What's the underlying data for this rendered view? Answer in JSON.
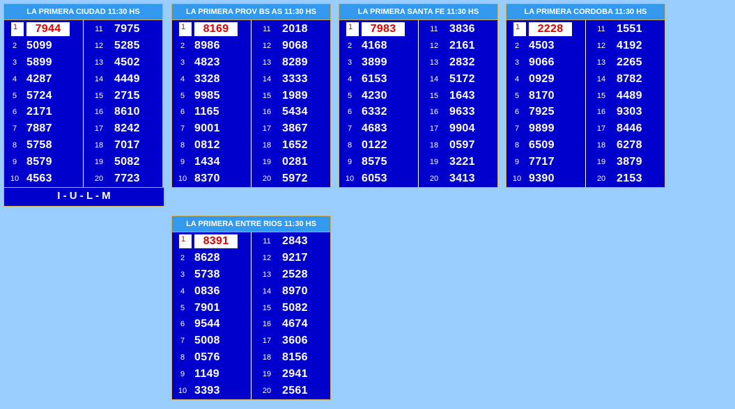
{
  "panels": [
    {
      "title": "LA PRIMERA CIUDAD 11:30 HS",
      "left": [
        "7944",
        "5099",
        "5899",
        "4287",
        "5724",
        "2171",
        "7887",
        "5758",
        "8579",
        "4563"
      ],
      "right": [
        "7975",
        "5285",
        "4502",
        "4449",
        "2715",
        "8610",
        "8242",
        "7017",
        "5082",
        "7723"
      ]
    },
    {
      "title": "LA PRIMERA PROV BS AS 11:30 HS",
      "left": [
        "8169",
        "8986",
        "4823",
        "3328",
        "9985",
        "1165",
        "9001",
        "0812",
        "1434",
        "8370"
      ],
      "right": [
        "2018",
        "9068",
        "8289",
        "3333",
        "1989",
        "5434",
        "3867",
        "1652",
        "0281",
        "5972"
      ]
    },
    {
      "title": "LA PRIMERA SANTA FE 11:30 HS",
      "left": [
        "7983",
        "4168",
        "3899",
        "6153",
        "4230",
        "6332",
        "4683",
        "0122",
        "8575",
        "6053"
      ],
      "right": [
        "3836",
        "2161",
        "2832",
        "5172",
        "1643",
        "9633",
        "9904",
        "0597",
        "3221",
        "3413"
      ]
    },
    {
      "title": "LA PRIMERA CORDOBA 11:30 HS",
      "left": [
        "2228",
        "4503",
        "9066",
        "0929",
        "8170",
        "7925",
        "9899",
        "6509",
        "7717",
        "9390"
      ],
      "right": [
        "1551",
        "4192",
        "2265",
        "8782",
        "4489",
        "9303",
        "8446",
        "6278",
        "3879",
        "2153"
      ]
    },
    {
      "title": "LA PRIMERA ENTRE RIOS 11:30 HS",
      "left": [
        "8391",
        "8628",
        "5738",
        "0836",
        "7901",
        "9544",
        "5008",
        "0576",
        "1149",
        "3393"
      ],
      "right": [
        "2843",
        "9217",
        "2528",
        "8970",
        "5082",
        "4674",
        "3606",
        "8156",
        "2941",
        "2561"
      ]
    }
  ],
  "footer": "I - U - L - M"
}
